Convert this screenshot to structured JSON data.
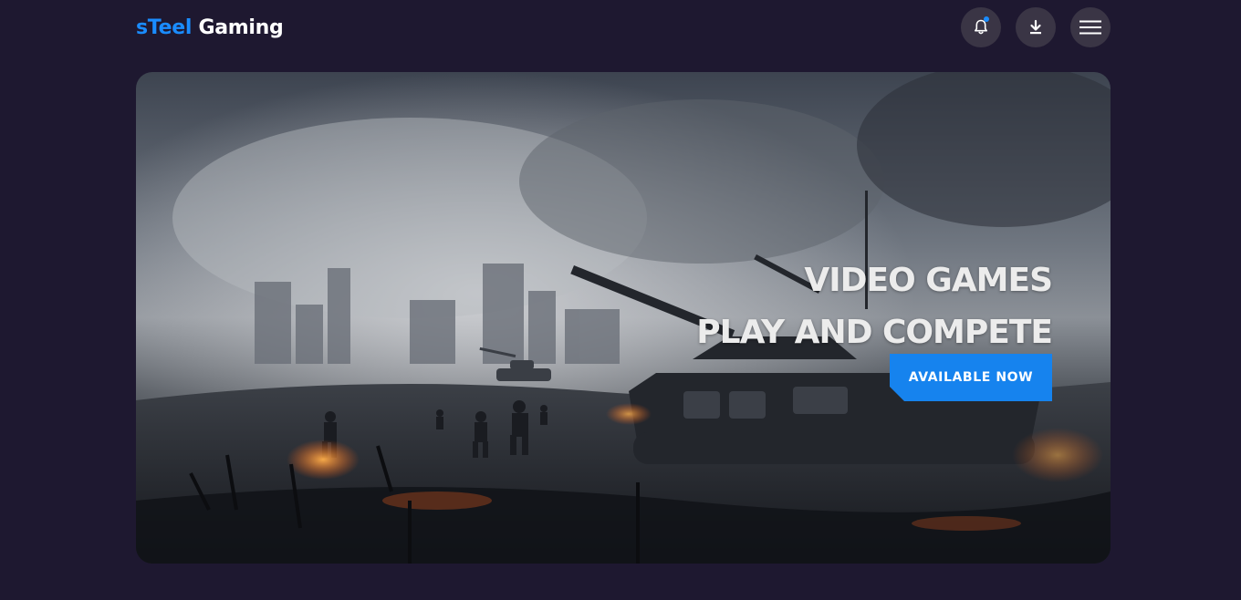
{
  "header": {
    "brand_accent": "sTeel",
    "brand_main": "Gaming",
    "actions": [
      {
        "name": "notifications",
        "icon": "bell-icon"
      },
      {
        "name": "download",
        "icon": "download-icon"
      },
      {
        "name": "menu",
        "icon": "hamburger-icon"
      }
    ]
  },
  "hero": {
    "line1": "VIDEO GAMES",
    "line2": "PLAY AND COMPETE",
    "cta_label": "AVAILABLE NOW",
    "image": "battlefield-tanks-smoke"
  },
  "colors": {
    "background": "#1e1830",
    "accent": "#1a8cff",
    "button": "#1683ee",
    "icon_button": "#3a3545"
  }
}
